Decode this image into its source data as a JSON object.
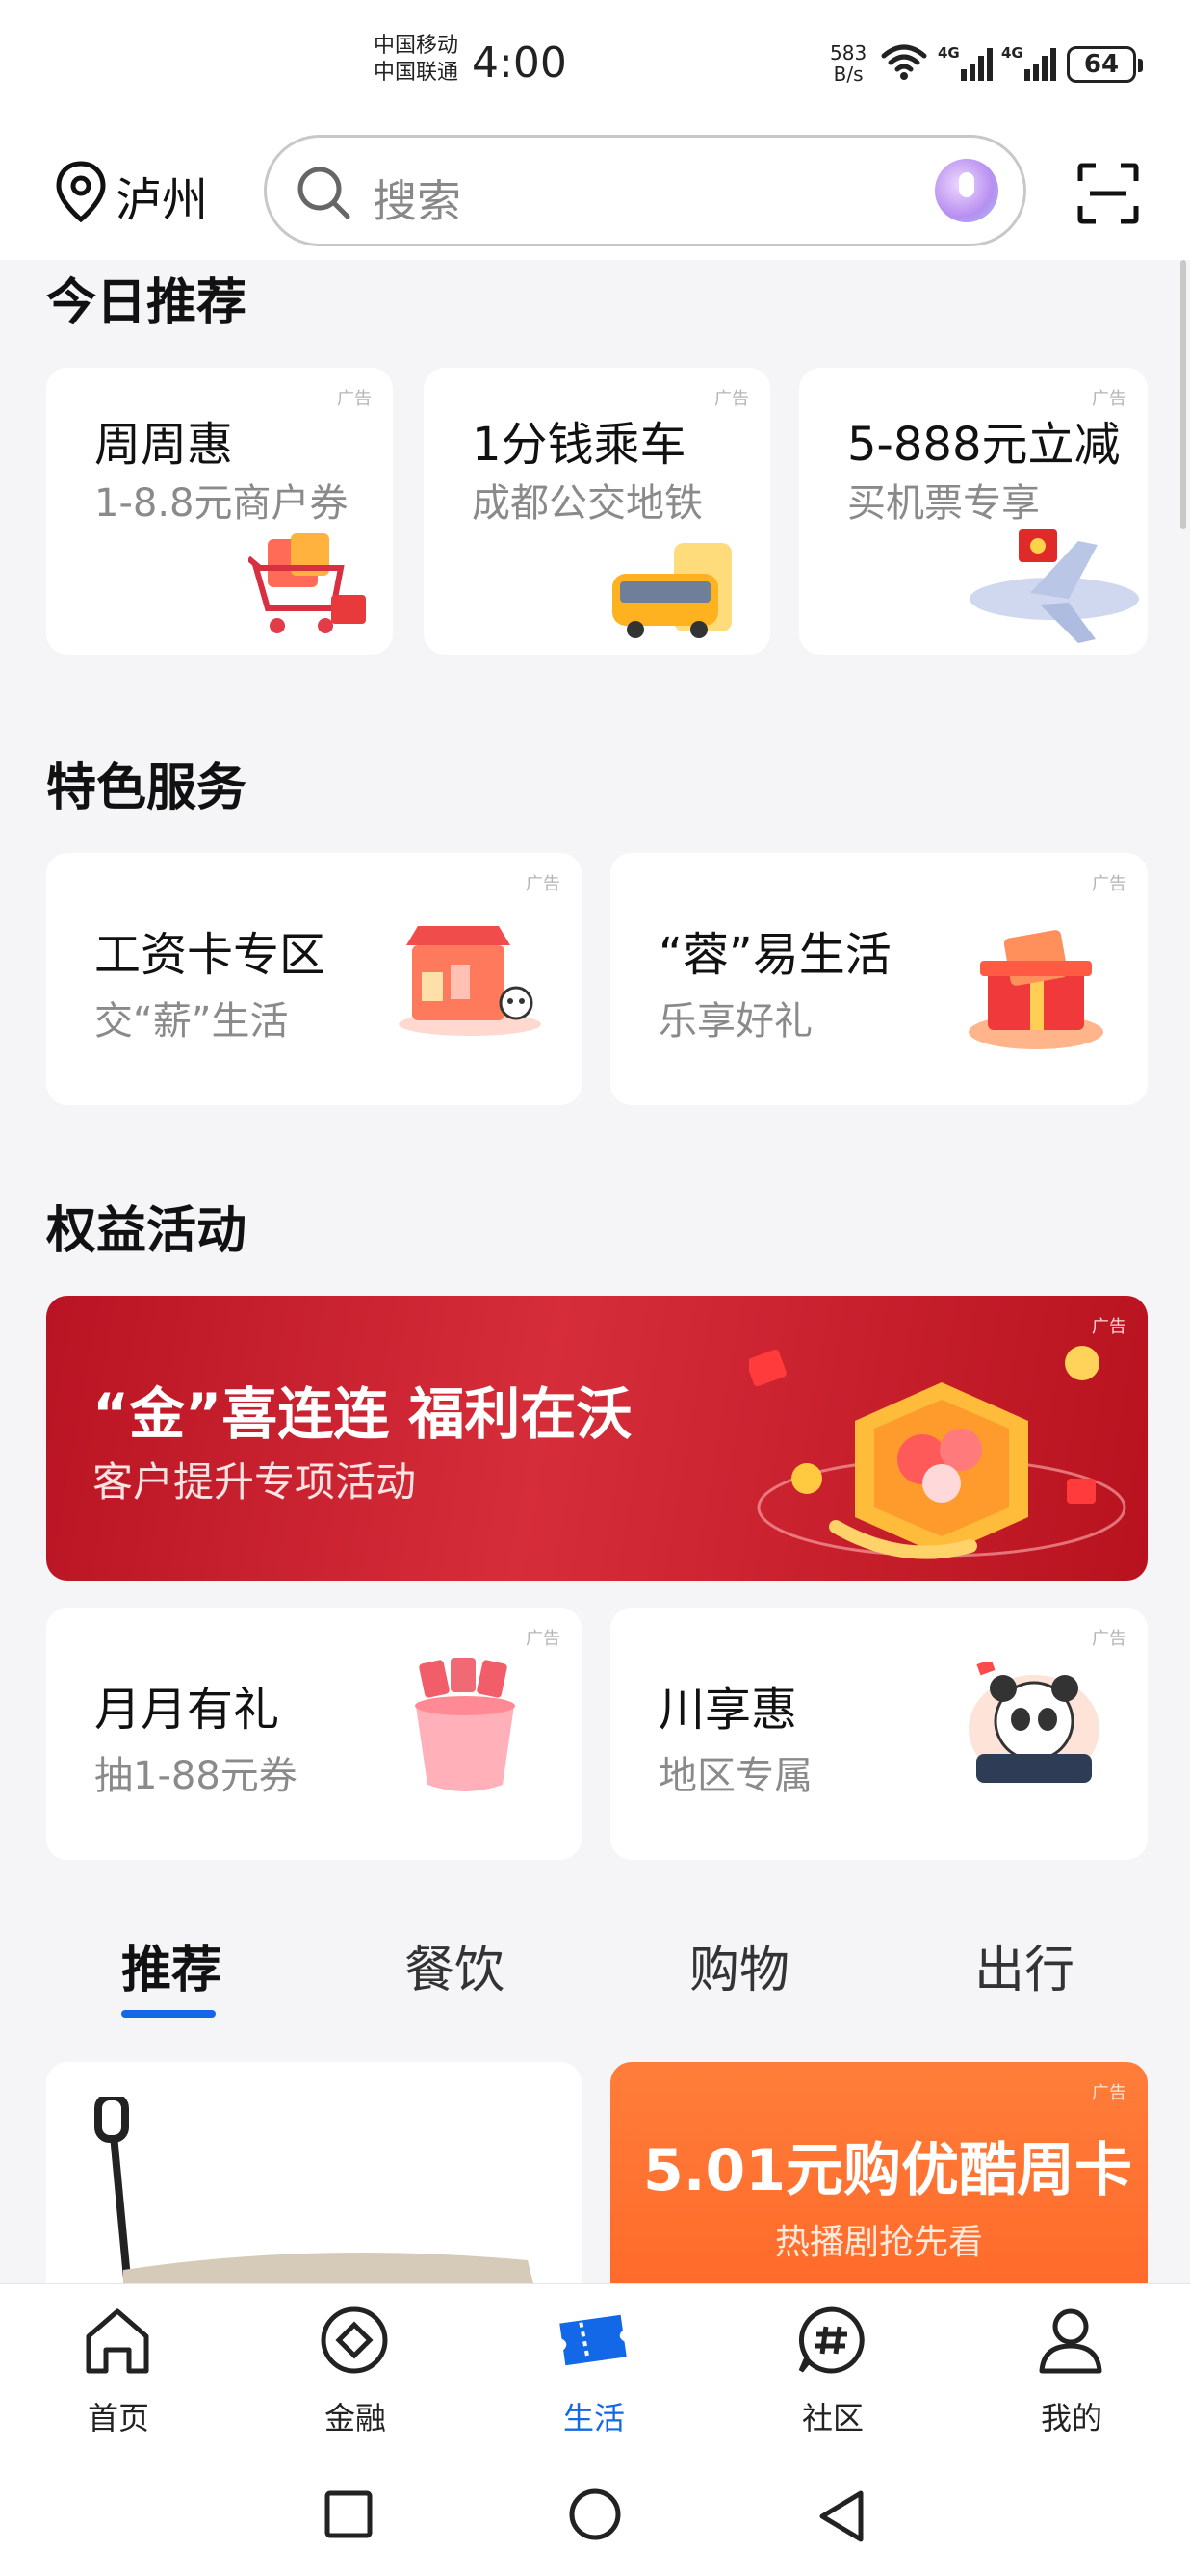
{
  "status_bar": {
    "carrier_1": "中国移动",
    "carrier_2": "中国联通",
    "time": "4:00",
    "net_speed_value": "583",
    "net_speed_unit": "B/s",
    "sig1_label": "4G",
    "sig2_label": "4G",
    "battery": "64"
  },
  "header": {
    "city": "泸州",
    "search_placeholder": "搜索"
  },
  "sections": {
    "today": "今日推荐",
    "featured": "特色服务",
    "benefits": "权益活动"
  },
  "ad_label": "广告",
  "today_cards": [
    {
      "title": "周周惠",
      "subtitle": "1-8.8元商户券"
    },
    {
      "title": "1分钱乘车",
      "subtitle": "成都公交地铁"
    },
    {
      "title": "5-888元立减",
      "subtitle": "买机票专享"
    }
  ],
  "featured_cards": [
    {
      "title": "工资卡专区",
      "subtitle": "交“薪”生活"
    },
    {
      "title": "“蓉”易生活",
      "subtitle": "乐享好礼"
    }
  ],
  "banner": {
    "title": "“金”喜连连 福利在沃",
    "subtitle": "客户提升专项活动"
  },
  "benefit_cards": [
    {
      "title": "月月有礼",
      "subtitle": "抽1-88元券"
    },
    {
      "title": "川享惠",
      "subtitle": "地区专属"
    }
  ],
  "tabs": [
    "推荐",
    "餐饮",
    "购物",
    "出行"
  ],
  "active_tab": "推荐",
  "feed": {
    "promo_title": "5.01元购优酷周卡",
    "promo_subtitle": "热播剧抢先看"
  },
  "bottom_nav": [
    {
      "label": "首页",
      "icon": "home-icon"
    },
    {
      "label": "金融",
      "icon": "finance-icon"
    },
    {
      "label": "生活",
      "icon": "ticket-icon"
    },
    {
      "label": "社区",
      "icon": "hashtag-icon"
    },
    {
      "label": "我的",
      "icon": "user-icon"
    }
  ],
  "active_nav": "生活",
  "colors": {
    "accent": "#1268e6",
    "banner_red": "#c8192a",
    "promo_orange": "#ff7435"
  }
}
